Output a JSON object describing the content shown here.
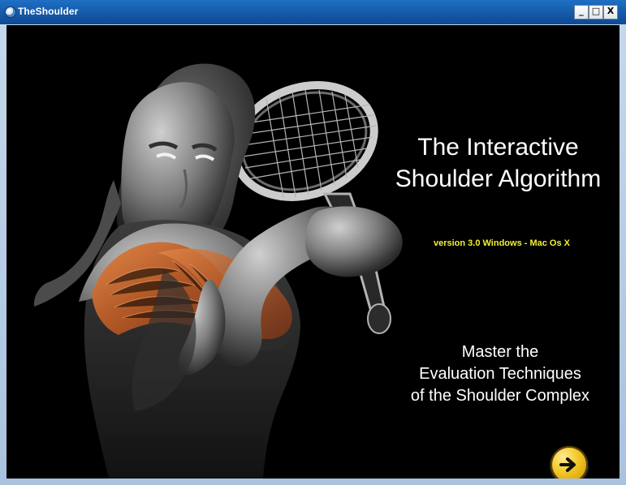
{
  "window": {
    "title": "TheShoulder",
    "controls": {
      "minimize": "_",
      "maximize": "□",
      "close": "X"
    }
  },
  "hero": {
    "title_line1": "The Interactive",
    "title_line2": "Shoulder Algorithm",
    "version": "version 3.0 Windows - Mac Os X",
    "subtitle_line1": "Master the",
    "subtitle_line2": "Evaluation Techniques",
    "subtitle_line3": "of the Shoulder Complex"
  },
  "icons": {
    "next": "arrow-right-icon"
  }
}
